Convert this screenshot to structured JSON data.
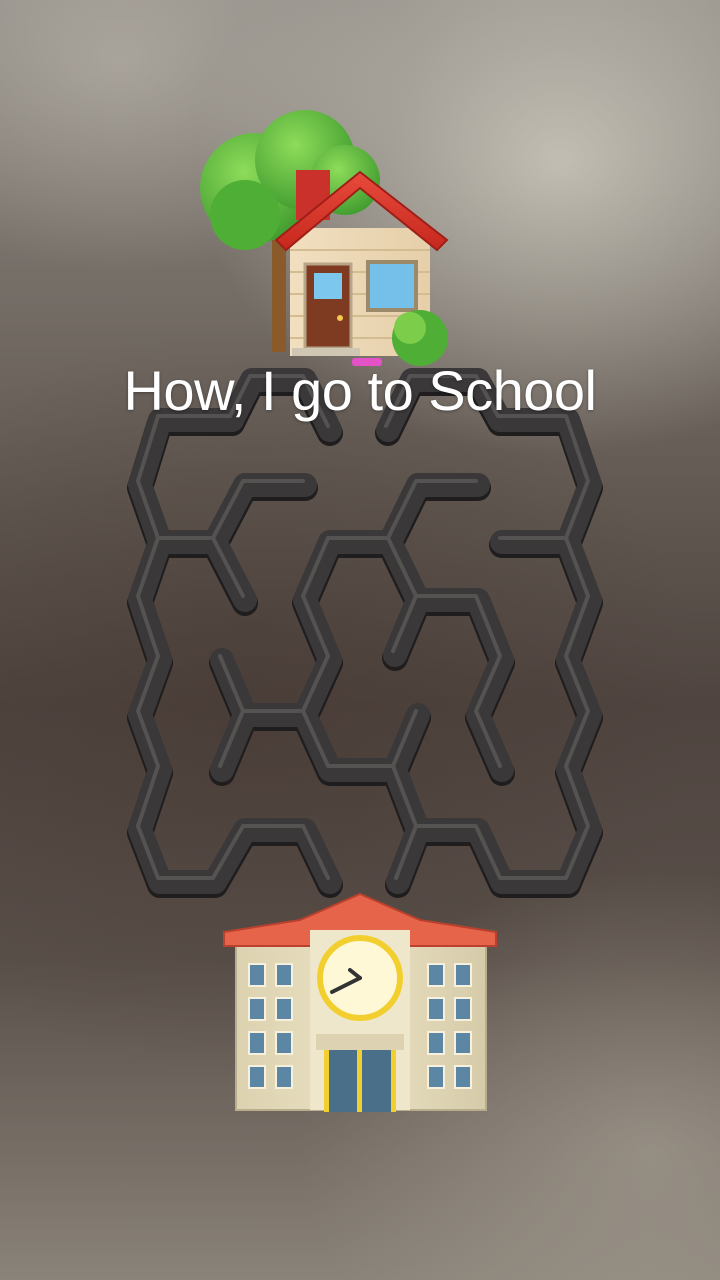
{
  "title": "How, I go to School",
  "start": {
    "icon": "house-with-tree-icon"
  },
  "goal": {
    "icon": "school-building-icon"
  },
  "colors": {
    "maze_wall": "#3a3838",
    "wall_highlight": "#6b6a68",
    "marker": "#e452c8"
  }
}
